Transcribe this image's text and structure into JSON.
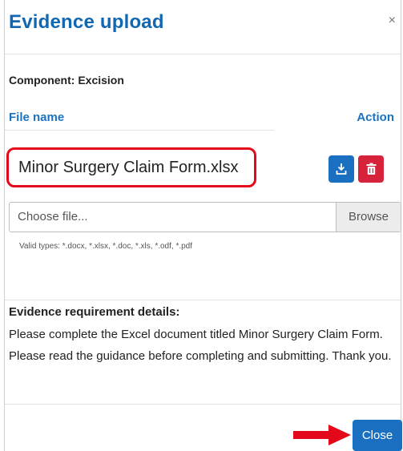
{
  "modal": {
    "title": "Evidence upload",
    "close_glyph": "×",
    "component_label": "Component: Excision"
  },
  "table": {
    "col_file": "File name",
    "col_action": "Action",
    "file_name": "Minor Surgery Claim Form.xlsx",
    "download_icon": "download-icon",
    "delete_icon": "trash-icon"
  },
  "upload": {
    "placeholder": "Choose file...",
    "browse_label": "Browse",
    "valid_types": "Valid types: *.docx, *.xlsx, *.doc, *.xls, *.odf, *.pdf"
  },
  "requirements": {
    "title": "Evidence requirement details:",
    "body": "Please complete the Excel document titled Minor Surgery Claim Form. Please read the guidance before completing and submitting. Thank you."
  },
  "footer": {
    "close_label": "Close"
  },
  "colors": {
    "primary": "#1a6fc0",
    "danger": "#d6223a",
    "highlight": "#e3081a",
    "heading_blue": "#1167b1"
  }
}
